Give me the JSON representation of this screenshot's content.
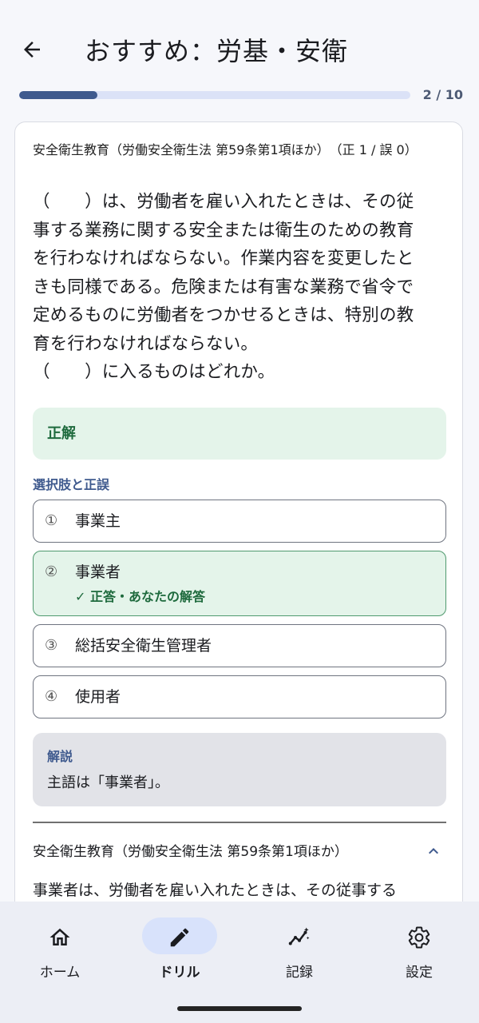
{
  "header": {
    "title": "おすすめ：労基・安衛",
    "back_icon": "arrow-left-icon"
  },
  "progress": {
    "current": 2,
    "total": 10,
    "text": "2 / 10",
    "fraction": 0.2
  },
  "card": {
    "category": "安全衛生教育（労働安全衛生法 第59条第1項ほか）　（正 1 / 誤 0）",
    "question_lines": [
      "（　　）は、労働者を雇い入れたときは、その従",
      "事する業務に関する安全または衛生のための教育",
      "を行わなければならない。作業内容を変更したと",
      "きも同様である。危険または有害な業務で省令で",
      "定めるものに労働者をつかせるときは、特別の教",
      "育を行わなければならない。",
      "（　　）に入るものはどれか。"
    ],
    "result_label": "正解",
    "choices_header": "選択肢と正誤",
    "choices": [
      {
        "num": "①",
        "text": "事業主",
        "note": ""
      },
      {
        "num": "②",
        "text": "事業者",
        "note": "✓ 正答・あなたの解答"
      },
      {
        "num": "③",
        "text": "総括安全衛生管理者",
        "note": ""
      },
      {
        "num": "④",
        "text": "使用者",
        "note": ""
      }
    ],
    "explanation": {
      "title": "解説",
      "text": "主語は「事業者」。"
    },
    "law": {
      "title": "安全衛生教育（労働安全衛生法 第59条第1項ほか）",
      "text": "事業者は、労働者を雇い入れたときは、その従事する"
    }
  },
  "nav": [
    {
      "label": "ホーム",
      "icon": "home-icon"
    },
    {
      "label": "ドリル",
      "icon": "pencil-icon"
    },
    {
      "label": "記録",
      "icon": "chart-icon"
    },
    {
      "label": "設定",
      "icon": "gear-icon"
    }
  ],
  "colors": {
    "accent": "#3f5a8e",
    "correct_bg": "#e4f4ea",
    "correct_text": "#1e6a3d",
    "nav_active_pill": "#d8e2fb"
  }
}
